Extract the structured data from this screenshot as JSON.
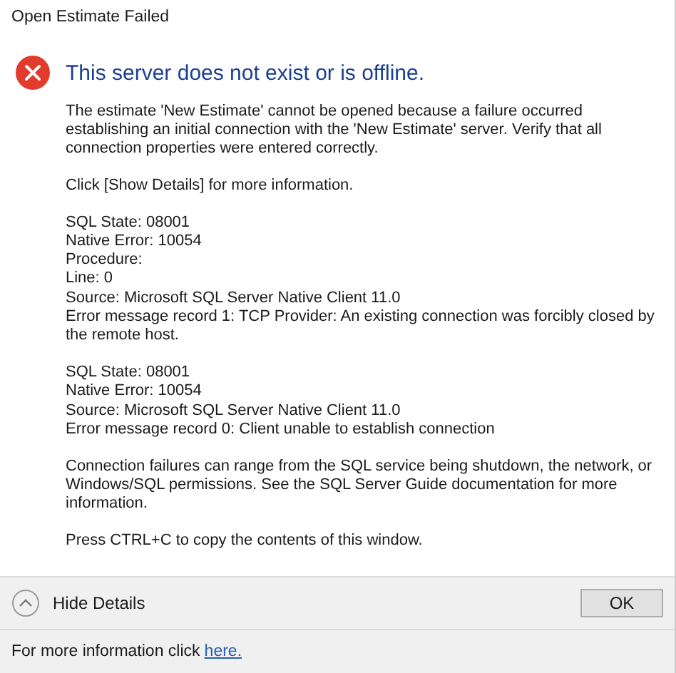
{
  "window": {
    "title": "Open Estimate Failed"
  },
  "heading": "This server does not exist or is offline.",
  "blocks": [
    {
      "kind": "paragraph",
      "text": "The estimate 'New Estimate' cannot be opened because a failure occurred establishing an initial connection with the 'New Estimate' server. Verify that all connection properties were entered correctly."
    },
    {
      "kind": "paragraph",
      "text": "Click [Show Details] for more information."
    },
    {
      "kind": "lines",
      "lines": [
        "SQL State: 08001",
        "Native Error: 10054",
        "Procedure:",
        "Line: 0",
        "Source: Microsoft SQL Server Native Client 11.0",
        "Error message record 1: TCP Provider: An existing connection was forcibly closed by the remote host."
      ]
    },
    {
      "kind": "lines",
      "lines": [
        "SQL State: 08001",
        "Native Error: 10054",
        "Source: Microsoft SQL Server Native Client 11.0",
        "Error message record 0: Client unable to establish connection"
      ]
    },
    {
      "kind": "paragraph",
      "text": "Connection failures can range from the SQL service being shutdown, the network, or Windows/SQL permissions. See the SQL Server Guide documentation for more information."
    },
    {
      "kind": "paragraph",
      "text": "Press CTRL+C to copy the contents of this window."
    }
  ],
  "details_toggle": {
    "label": "Hide Details",
    "expanded": true
  },
  "buttons": [
    "OK"
  ],
  "footer": {
    "text": "For more information click",
    "link": "here."
  }
}
